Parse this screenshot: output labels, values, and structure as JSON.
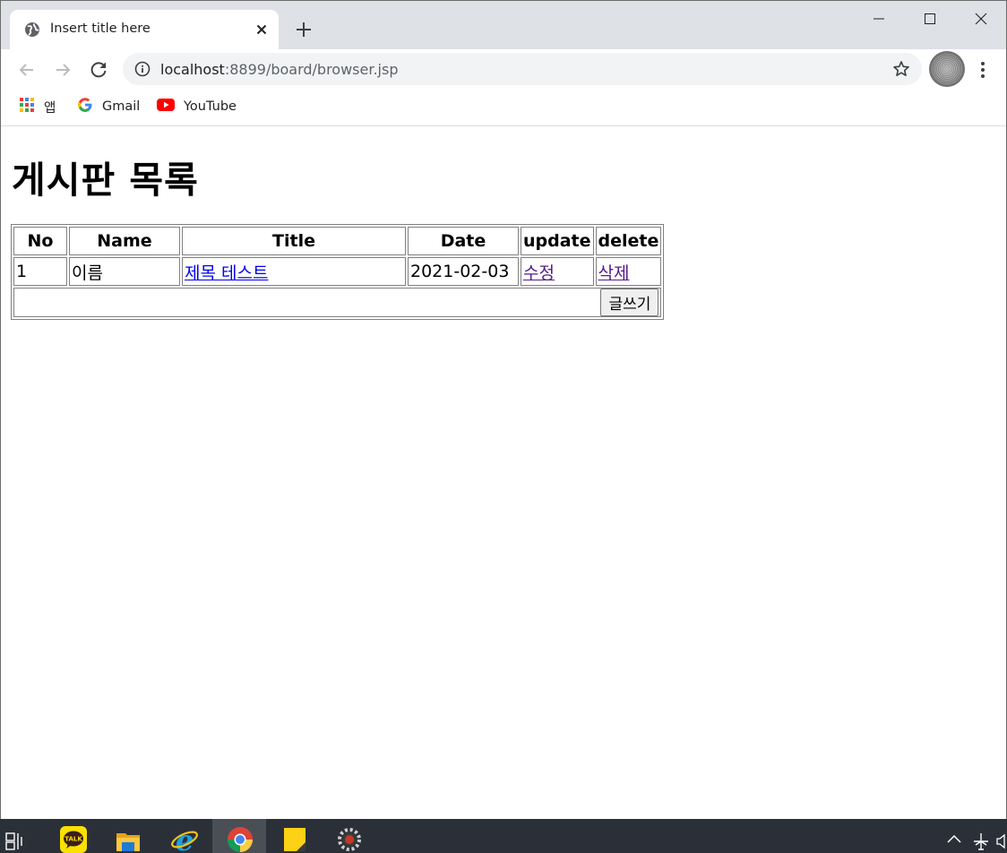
{
  "browser": {
    "tab": {
      "title": "Insert title here"
    },
    "url": {
      "host": "localhost",
      "rest": ":8899/board/browser.jsp"
    },
    "bookmarks": [
      {
        "label": "앱",
        "icon": "apps-grid-icon"
      },
      {
        "label": "Gmail",
        "icon": "google-g-icon"
      },
      {
        "label": "YouTube",
        "icon": "youtube-icon"
      }
    ]
  },
  "page": {
    "heading": "게시판 목록",
    "table": {
      "headers": [
        "No",
        "Name",
        "Title",
        "Date",
        "update",
        "delete"
      ],
      "rows": [
        {
          "no": "1",
          "name": "이름",
          "title": "제목 테스트",
          "date": "2021-02-03",
          "update": "수정",
          "delete": "삭제"
        }
      ],
      "write_button": "글쓰기"
    }
  },
  "taskbar": {
    "apps": [
      "task-view-icon",
      "kakaotalk-icon",
      "file-explorer-icon",
      "internet-explorer-icon",
      "chrome-icon",
      "sticky-notes-icon",
      "settings-gear-icon"
    ],
    "active": "chrome-icon"
  },
  "colors": {
    "tabstrip": "#dee1e6",
    "link": "#0000ee",
    "visited_link": "#551a8b",
    "taskbar": "#2b3038"
  }
}
